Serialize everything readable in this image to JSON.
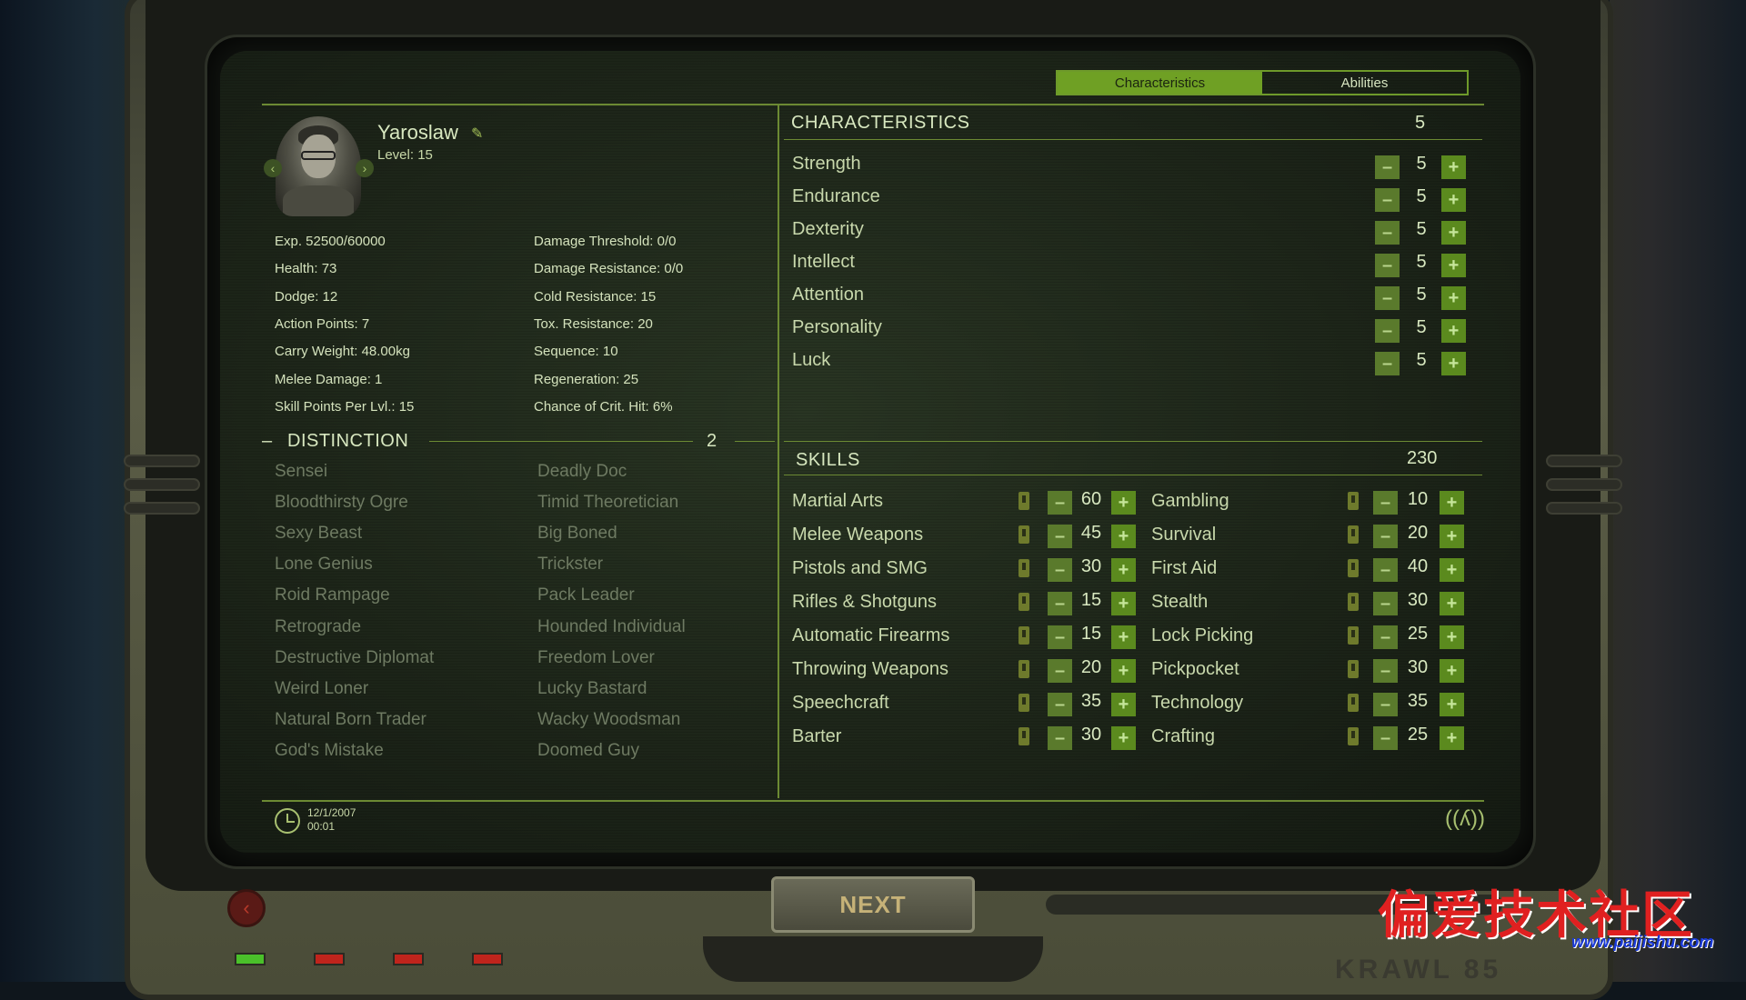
{
  "tabs": [
    {
      "label": "Characteristics",
      "active": true
    },
    {
      "label": "Abilities",
      "active": false
    }
  ],
  "character": {
    "name": "Yaroslaw",
    "level": "Level: 15"
  },
  "stats_left": [
    "Exp. 52500/60000",
    "Health: 73",
    "Dodge: 12",
    "Action Points: 7",
    "Carry Weight: 48.00kg",
    "Melee Damage: 1",
    "Skill Points Per Lvl.: 15"
  ],
  "stats_right": [
    "Damage Threshold: 0/0",
    "Damage Resistance: 0/0",
    "Cold Resistance: 15",
    "Tox. Resistance: 20",
    "Sequence: 10",
    "Regeneration: 25",
    "Chance of Crit. Hit: 6%"
  ],
  "distinction": {
    "title": "DISTINCTION",
    "points": "2",
    "collapse": "–",
    "left": [
      "Sensei",
      "Bloodthirsty Ogre",
      "Sexy Beast",
      "Lone Genius",
      "Roid Rampage",
      "Retrograde",
      "Destructive Diplomat",
      "Weird Loner",
      "Natural Born Trader",
      "God's Mistake"
    ],
    "right": [
      "Deadly Doc",
      "Timid Theoretician",
      "Big Boned",
      "Trickster",
      "Pack Leader",
      "Hounded Individual",
      "Freedom Lover",
      "Lucky Bastard",
      "Wacky Woodsman",
      "Doomed Guy"
    ]
  },
  "characteristics": {
    "title": "CHARACTERISTICS",
    "points": "5",
    "items": [
      {
        "name": "Strength",
        "value": "5"
      },
      {
        "name": "Endurance",
        "value": "5"
      },
      {
        "name": "Dexterity",
        "value": "5"
      },
      {
        "name": "Intellect",
        "value": "5"
      },
      {
        "name": "Attention",
        "value": "5"
      },
      {
        "name": "Personality",
        "value": "5"
      },
      {
        "name": "Luck",
        "value": "5"
      }
    ]
  },
  "skills": {
    "title": "SKILLS",
    "points": "230",
    "left": [
      {
        "name": "Martial Arts",
        "value": "60"
      },
      {
        "name": "Melee Weapons",
        "value": "45"
      },
      {
        "name": "Pistols and SMG",
        "value": "30"
      },
      {
        "name": "Rifles & Shotguns",
        "value": "15"
      },
      {
        "name": "Automatic Firearms",
        "value": "15"
      },
      {
        "name": "Throwing Weapons",
        "value": "20"
      },
      {
        "name": "Speechcraft",
        "value": "35"
      },
      {
        "name": "Barter",
        "value": "30"
      }
    ],
    "right": [
      {
        "name": "Gambling",
        "value": "10"
      },
      {
        "name": "Survival",
        "value": "20"
      },
      {
        "name": "First Aid",
        "value": "40"
      },
      {
        "name": "Stealth",
        "value": "30"
      },
      {
        "name": "Lock Picking",
        "value": "25"
      },
      {
        "name": "Pickpocket",
        "value": "30"
      },
      {
        "name": "Technology",
        "value": "35"
      },
      {
        "name": "Crafting",
        "value": "25"
      }
    ]
  },
  "footer": {
    "date": "12/1/2007",
    "time": "00:01"
  },
  "controls": {
    "next_label": "NEXT",
    "plus": "+",
    "minus": "–",
    "back_symbol": "‹",
    "prev_symbol": "‹",
    "next_symbol": "›",
    "pencil_symbol": "✎",
    "signal_symbol": "((ʎ))"
  },
  "watermark": {
    "text": "偏爱技术社区",
    "url": "www.paijishu.com"
  },
  "logo": "KRAWL 85",
  "icons": [
    "clock-icon",
    "pencil-icon",
    "signal-icon",
    "lock-icon"
  ]
}
